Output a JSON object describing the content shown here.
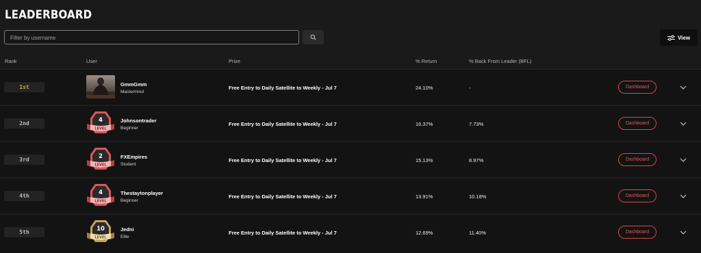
{
  "title": "LEADERBOARD",
  "search": {
    "placeholder": "Filter by username",
    "value": ""
  },
  "view_label": "View",
  "columns": {
    "rank": "Rank",
    "user": "User",
    "prize": "Prize",
    "return": "% Return",
    "bfl": "% Back From Leader (BFL)"
  },
  "dashboard_label": "Dashboard",
  "level_word": "LEVEL",
  "rows": [
    {
      "rank": "1st",
      "username": "GmmGmm",
      "tier": "Mastermind",
      "prize": "Free Entry to Daily Satellite to Weekly - Jul 7",
      "return": "24.10%",
      "bfl": "-"
    },
    {
      "rank": "2nd",
      "username": "Johnsontrader",
      "tier": "Beginner",
      "level": "4",
      "prize": "Free Entry to Daily Satellite to Weekly - Jul 7",
      "return": "16.37%",
      "bfl": "7.73%"
    },
    {
      "rank": "3rd",
      "username": "FXEmpires",
      "tier": "Student",
      "level": "2",
      "prize": "Free Entry to Daily Satellite to Weekly - Jul 7",
      "return": "15.13%",
      "bfl": "8.97%"
    },
    {
      "rank": "4th",
      "username": "Thestaytonplayer",
      "tier": "Beginner",
      "level": "4",
      "prize": "Free Entry to Daily Satellite to Weekly - Jul 7",
      "return": "13.91%",
      "bfl": "10.18%"
    },
    {
      "rank": "5th",
      "username": "Jedni",
      "tier": "Elite",
      "level": "10",
      "prize": "Free Entry to Daily Satellite to Weekly - Jul 7",
      "return": "12.69%",
      "bfl": "11.40%"
    }
  ],
  "colors": {
    "accent_red": "#d94848",
    "gold_rank": "#d4a84b",
    "level_red": "#d9575c",
    "level_gold": "#c9a15a"
  }
}
